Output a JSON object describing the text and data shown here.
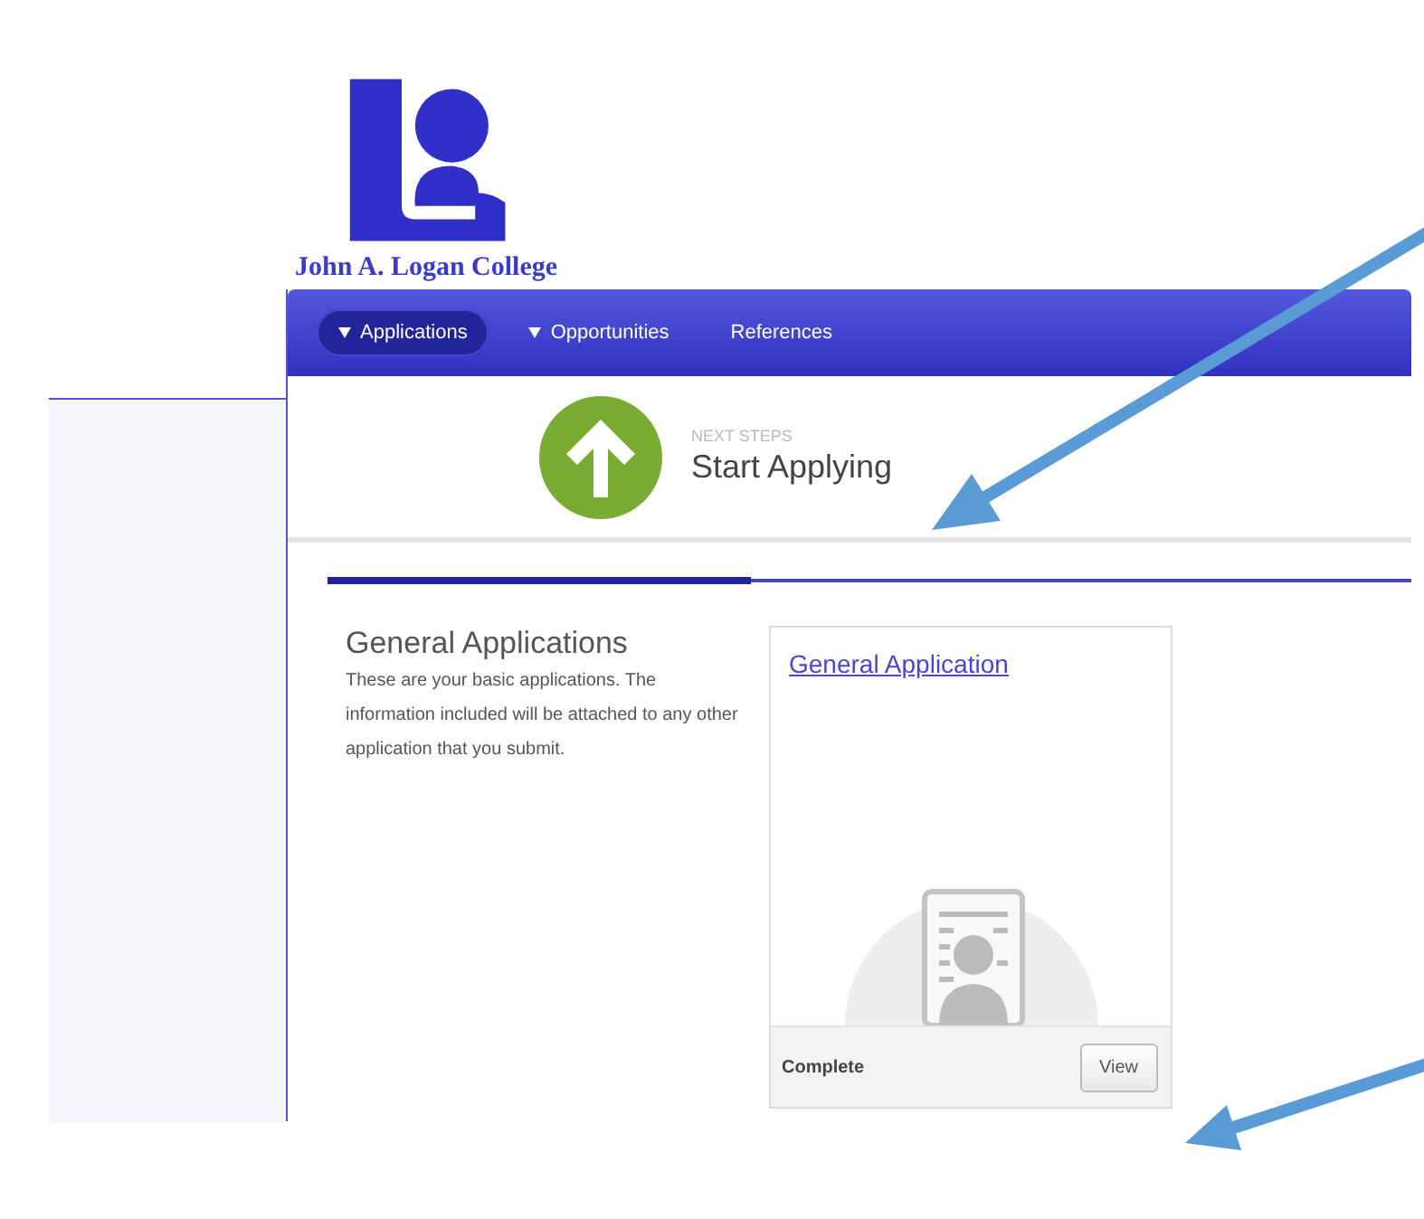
{
  "logo": {
    "name": "John A. Logan College"
  },
  "nav": [
    {
      "label": "Applications",
      "selected": true,
      "has_menu": true
    },
    {
      "label": "Opportunities",
      "selected": false,
      "has_menu": true
    },
    {
      "label": "References",
      "selected": false,
      "has_menu": false
    }
  ],
  "next_steps": {
    "label": "NEXT STEPS",
    "title": "Start Applying"
  },
  "progress": {
    "level": 0.39
  },
  "section": {
    "title": "General Applications",
    "description": "These are your basic applications. The information included will be attached to any other application that you submit."
  },
  "cards": [
    {
      "title": "General Application",
      "status": "Complete",
      "button": "View"
    }
  ]
}
